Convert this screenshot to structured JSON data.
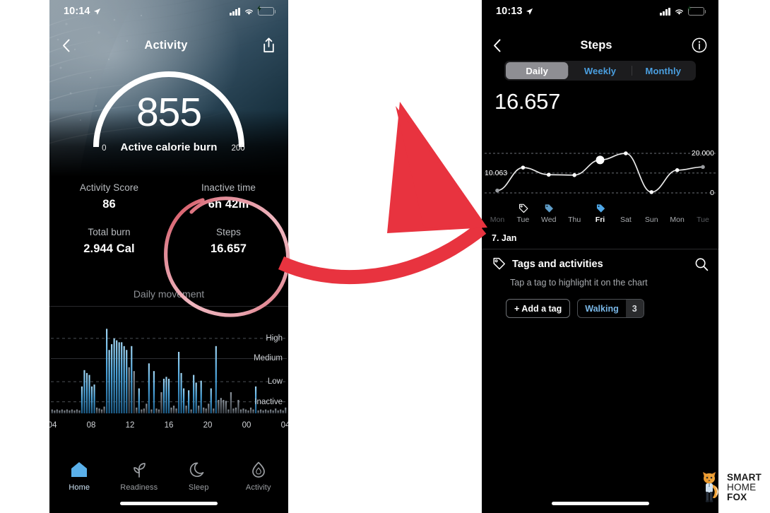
{
  "left_phone": {
    "status": {
      "time": "10:14",
      "location_icon": "location-arrow-icon",
      "cellular_icon": "cellular-bars-icon",
      "wifi_icon": "wifi-icon",
      "battery_icon": "battery-charging-icon"
    },
    "nav": {
      "back_icon": "chevron-left-icon",
      "title": "Activity",
      "share_icon": "share-upload-icon"
    },
    "gauge": {
      "value": "855",
      "label": "Active calorie burn",
      "min": "0",
      "max": "200",
      "progress_pct": 100,
      "arc_color": "#ffffff"
    },
    "stats": [
      {
        "key": "Activity Score",
        "value": "86"
      },
      {
        "key": "Inactive time",
        "value": "6h 42m"
      },
      {
        "key": "Total burn",
        "value": "2.944 Cal"
      },
      {
        "key": "Steps",
        "value": "16.657"
      }
    ],
    "section_label": "Daily movement",
    "tabs": [
      {
        "label": "Home",
        "icon": "home-icon",
        "active": true
      },
      {
        "label": "Readiness",
        "icon": "sprout-icon",
        "active": false
      },
      {
        "label": "Sleep",
        "icon": "moon-icon",
        "active": false
      },
      {
        "label": "Activity",
        "icon": "flame-drop-icon",
        "active": false
      }
    ],
    "home_indicator": true
  },
  "right_phone": {
    "status": {
      "time": "10:13",
      "location_icon": "location-arrow-icon",
      "cellular_icon": "cellular-bars-icon",
      "wifi_icon": "wifi-icon",
      "battery_icon": "battery-charging-icon"
    },
    "nav": {
      "back_icon": "chevron-left-icon",
      "title": "Steps",
      "info_icon": "info-circle-icon"
    },
    "segments": [
      {
        "label": "Daily",
        "selected": true
      },
      {
        "label": "Weekly",
        "selected": false
      },
      {
        "label": "Monthly",
        "selected": false
      }
    ],
    "headline_value": "16.657",
    "selected_date": "7. Jan",
    "days": [
      {
        "label": "Mon",
        "tag": "none",
        "state": "dim",
        "value": 1200
      },
      {
        "label": "Tue",
        "tag": "tag-outline",
        "state": "nor",
        "value": 12800
      },
      {
        "label": "Wed",
        "tag": "tag-filled-dim",
        "state": "nor",
        "value": 9200
      },
      {
        "label": "Thu",
        "tag": "none",
        "state": "nor",
        "value": 9000
      },
      {
        "label": "Fri",
        "tag": "tag-filled",
        "state": "sel",
        "value": 16657
      },
      {
        "label": "Sat",
        "tag": "none",
        "state": "nor",
        "value": 20000
      },
      {
        "label": "Sun",
        "tag": "none",
        "state": "nor",
        "value": 400
      },
      {
        "label": "Mon",
        "tag": "none",
        "state": "nor",
        "value": 11500
      },
      {
        "label": "Tue",
        "tag": "none",
        "state": "dim",
        "value": 13100
      }
    ],
    "tags": {
      "tag_icon": "tag-icon",
      "title": "Tags and activities",
      "search_icon": "search-icon",
      "subtitle": "Tap a tag to highlight it on the chart",
      "add_label": "+ Add a tag",
      "chips": [
        {
          "name": "Walking",
          "count": "3"
        }
      ]
    },
    "home_indicator": true
  },
  "chart_data": [
    {
      "type": "bar",
      "title": "Daily movement",
      "xlabel": "",
      "ylabel": "",
      "ylim": [
        0,
        100
      ],
      "ytick_labels": [
        "High",
        "Medium",
        "Low",
        "Inactive"
      ],
      "ytick_positions": [
        78,
        57,
        33,
        12
      ],
      "xtick_labels": [
        "04",
        "08",
        "12",
        "16",
        "20",
        "00",
        "04"
      ],
      "grid": true,
      "active_color": "#4ea8e0",
      "inactive_color": "#6e757c",
      "values": [
        4,
        3,
        4,
        3,
        4,
        3,
        4,
        3,
        4,
        3,
        4,
        3,
        28,
        45,
        42,
        40,
        28,
        30,
        6,
        5,
        4,
        7,
        88,
        66,
        72,
        78,
        76,
        74,
        74,
        70,
        66,
        48,
        70,
        44,
        6,
        26,
        4,
        5,
        10,
        52,
        4,
        44,
        5,
        4,
        22,
        36,
        38,
        36,
        6,
        8,
        5,
        64,
        42,
        26,
        8,
        24,
        4,
        40,
        32,
        8,
        34,
        6,
        5,
        10,
        26,
        5,
        70,
        14,
        16,
        14,
        13,
        4,
        22,
        5,
        6,
        14,
        4,
        5,
        4,
        3,
        6,
        4,
        28,
        3,
        4,
        3,
        4,
        3,
        4,
        3,
        5,
        3,
        4,
        3,
        6
      ],
      "inactive_flags": [
        true,
        true,
        true,
        true,
        true,
        true,
        true,
        true,
        true,
        true,
        true,
        true,
        false,
        false,
        false,
        false,
        false,
        false,
        true,
        true,
        true,
        true,
        false,
        false,
        false,
        false,
        false,
        false,
        false,
        false,
        false,
        true,
        false,
        true,
        true,
        false,
        true,
        true,
        true,
        false,
        true,
        false,
        true,
        true,
        true,
        false,
        false,
        false,
        true,
        true,
        true,
        false,
        false,
        false,
        true,
        false,
        true,
        false,
        false,
        true,
        false,
        true,
        true,
        true,
        false,
        true,
        false,
        true,
        true,
        true,
        true,
        true,
        true,
        true,
        true,
        true,
        true,
        true,
        true,
        true,
        true,
        true,
        false,
        true,
        true,
        true,
        true,
        true,
        true,
        true,
        true,
        true,
        true,
        true,
        true
      ]
    },
    {
      "type": "line",
      "title": "Steps",
      "xlabel": "",
      "ylabel": "",
      "categories": [
        "Mon",
        "Tue",
        "Wed",
        "Thu",
        "Fri",
        "Sat",
        "Sun",
        "Mon",
        "Tue"
      ],
      "values": [
        1200,
        12800,
        9200,
        9000,
        16657,
        20000,
        400,
        11500,
        13100
      ],
      "ylim": [
        0,
        20000
      ],
      "gridlines": [
        {
          "value": 20000,
          "label": "20.000",
          "side": "right"
        },
        {
          "value": 10063,
          "label": "10.063",
          "side": "left"
        },
        {
          "value": 0,
          "label": "0",
          "side": "right"
        }
      ],
      "highlight_index": 4,
      "line_color": "#e8e8e8",
      "grid": true
    }
  ],
  "annotations": {
    "circle": {
      "shape": "hand-drawn-ellipse",
      "color": "#e9a0ab",
      "target": "steps-value"
    },
    "arrow": {
      "shape": "curved-arrow",
      "color": "#e8333f",
      "direction": "right"
    }
  },
  "watermark": {
    "line1": "SMART",
    "line2": "HOME",
    "line3": "FOX",
    "mascot": "fox-mascot-icon"
  }
}
